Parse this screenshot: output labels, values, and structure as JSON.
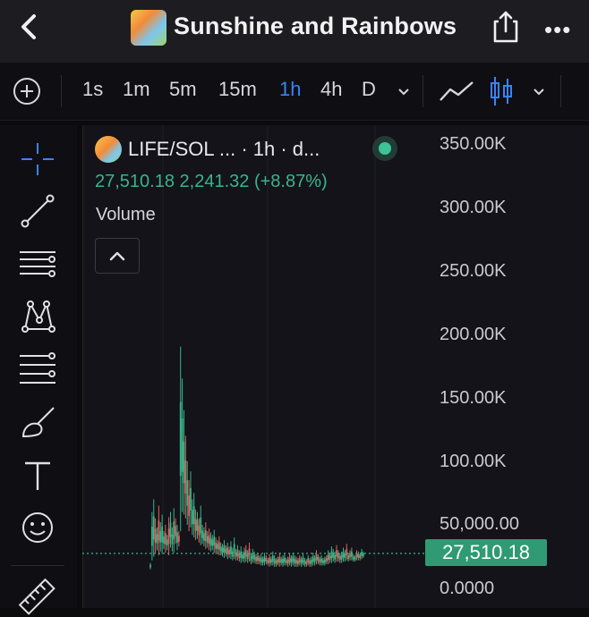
{
  "header": {
    "title": "Sunshine and Rainbows",
    "icons": [
      "back-chevron-icon",
      "token-avatar",
      "share-icon",
      "more-icon"
    ]
  },
  "toolbar": {
    "timeframes": [
      "1s",
      "1m",
      "5m",
      "15m",
      "1h",
      "4h",
      "D"
    ],
    "active_timeframe": "1h",
    "accent_color": "#3b82f6",
    "icons": [
      "plus-circle-icon",
      "chevron-down-icon",
      "line-chart-icon",
      "candlestick-icon",
      "chevron-down-icon"
    ]
  },
  "left_tools": [
    "crosshair-icon",
    "trend-line-icon",
    "horizontal-lines-icon",
    "pattern-icon",
    "fib-retracement-icon",
    "brush-icon",
    "text-icon",
    "emoji-icon",
    "ruler-icon"
  ],
  "legend": {
    "pair": "LIFE/SOL ... · 1h · d...",
    "last": "27,510.18",
    "change": "2,241.32",
    "change_pct": "(+8.87%)",
    "volume_label": "Volume",
    "up_color": "#39b58a",
    "status": "live"
  },
  "price_axis": {
    "labels": [
      "350.00K",
      "300.00K",
      "250.00K",
      "200.00K",
      "150.00K",
      "100.00K",
      "50,000.00",
      "0.0000"
    ],
    "current_price_tag": "27,510.18"
  },
  "chart_data": {
    "type": "candlestick",
    "ylim": [
      0,
      350000
    ],
    "up_color": "#39b58a",
    "down_color": "#e5605b",
    "current_price": 27510.18,
    "series": [
      {
        "values_high": [
          20000,
          60000,
          70000,
          55000,
          48000,
          65000,
          52000,
          58000,
          45000,
          50000,
          42000,
          56000,
          60000,
          48000,
          63000,
          55000,
          50000,
          45000,
          190000,
          165000,
          140000,
          120000,
          100000,
          85000,
          92000,
          70000,
          75000,
          62000,
          60000,
          55000,
          65000,
          50000,
          48000,
          52000,
          45000,
          47000,
          44000,
          42000,
          46000,
          40000,
          38000,
          41000,
          36000,
          35000,
          38000,
          34000,
          36000,
          33000,
          37000,
          32000,
          40000,
          31000,
          34000,
          30000,
          33000,
          29000,
          32000,
          34000,
          30000,
          36000,
          28000,
          31000,
          29000,
          27000,
          28000,
          26000,
          27000,
          25000,
          28000,
          26000,
          24000,
          27000,
          25000,
          29000,
          26000,
          24000,
          25000,
          28000,
          25000,
          26000,
          27000,
          24000,
          25000,
          27000,
          26000,
          28000,
          26000,
          25000,
          24000,
          26000,
          25000,
          27000,
          24000,
          23000,
          26000,
          24000,
          25000,
          28000,
          26000,
          30000,
          27000,
          25000,
          26000,
          24000,
          25000,
          26000,
          30000,
          28000,
          33000,
          31000,
          29000,
          34000,
          30000,
          28000,
          29000,
          32000,
          30000,
          35000,
          28000,
          30000,
          32000,
          27000,
          26000,
          30000,
          29000,
          28000,
          31000,
          29000
        ],
        "values_low": [
          15000,
          22000,
          25000,
          28000,
          30000,
          26000,
          29000,
          27000,
          31000,
          28000,
          30000,
          26000,
          32000,
          29000,
          28000,
          35000,
          30000,
          33000,
          45000,
          60000,
          58000,
          55000,
          50000,
          45000,
          48000,
          42000,
          40000,
          38000,
          39000,
          36000,
          34000,
          35000,
          33000,
          31000,
          32000,
          30000,
          29000,
          30000,
          28000,
          27000,
          28000,
          26000,
          26000,
          25000,
          24000,
          25000,
          23000,
          24000,
          23000,
          22000,
          23000,
          22000,
          22000,
          21000,
          20000,
          21000,
          20000,
          21000,
          20000,
          21000,
          19000,
          20000,
          20000,
          19000,
          19000,
          19000,
          18000,
          18000,
          18000,
          19000,
          18000,
          17000,
          18000,
          18000,
          17000,
          17000,
          18000,
          17000,
          18000,
          17000,
          18000,
          18000,
          17000,
          18000,
          17000,
          18000,
          17000,
          17000,
          17000,
          18000,
          17000,
          18000,
          17000,
          17000,
          18000,
          17000,
          17000,
          18000,
          18000,
          19000,
          19000,
          18000,
          18000,
          18000,
          18000,
          19000,
          19000,
          20000,
          20000,
          21000,
          20000,
          21000,
          21000,
          20000,
          20000,
          21000,
          21000,
          22000,
          21000,
          22000,
          22000,
          21000,
          21000,
          22000,
          22000,
          22000,
          23000,
          24000
        ]
      }
    ]
  }
}
